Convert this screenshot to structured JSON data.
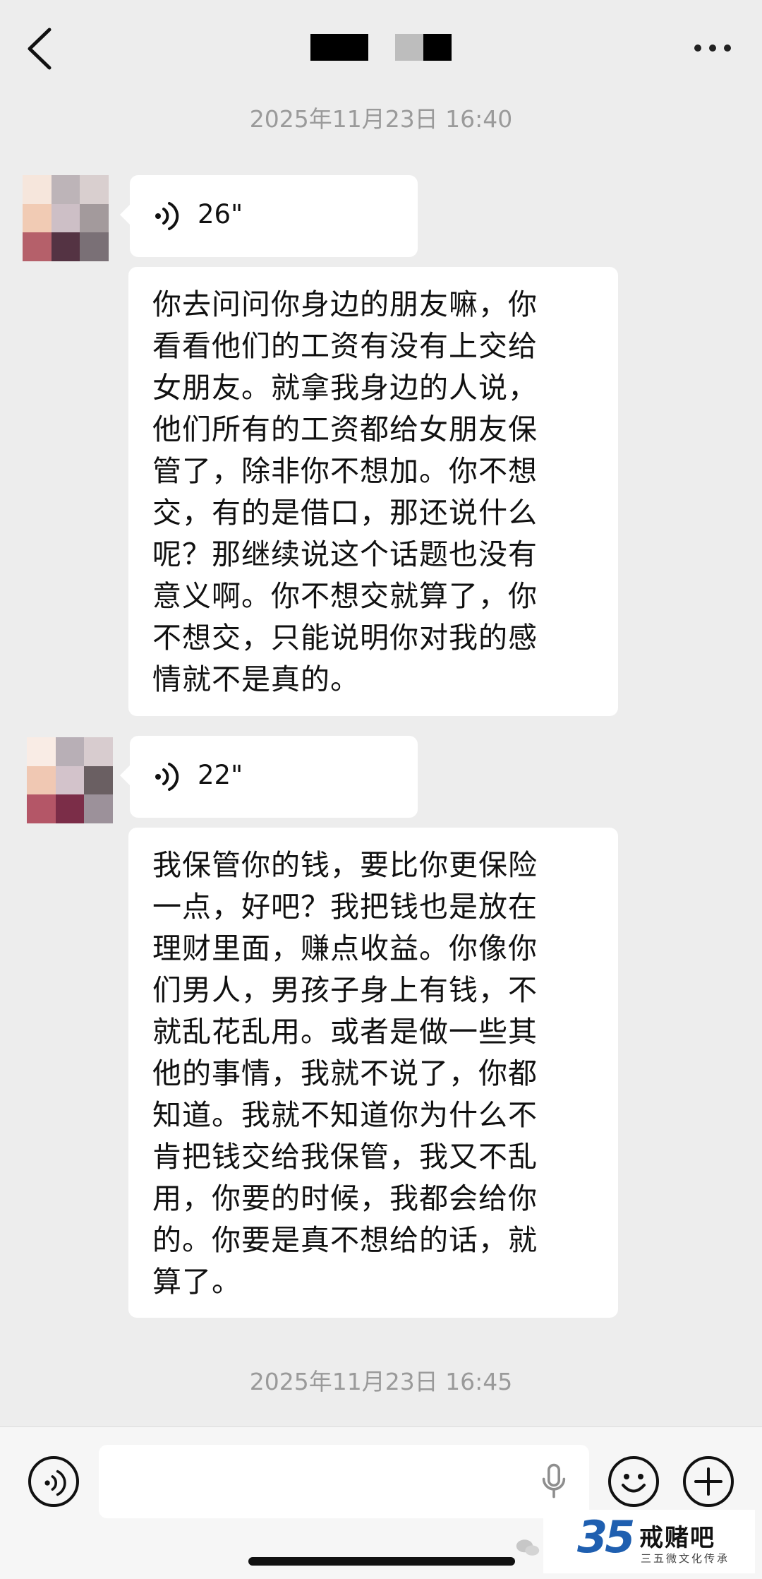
{
  "header": {
    "back_icon": "chevron-left-icon",
    "title_redacted": true,
    "more_icon": "more-dots-icon"
  },
  "messages": [
    {
      "type": "timestamp",
      "text": "2025年11月23日 16:40"
    },
    {
      "type": "voice",
      "duration": "26\""
    },
    {
      "type": "text",
      "lines": [
        "你去问问你身边的朋友嘛，你",
        "看看他们的工资有没有上交给",
        "女朋友。就拿我身边的人说，",
        "他们所有的工资都给女朋友保",
        "管了，除非你不想加。你不想",
        "交，有的是借口，那还说什么",
        "呢？那继续说这个话题也没有",
        "意义啊。你不想交就算了，你",
        "不想交，只能说明你对我的感",
        "情就不是真的。"
      ]
    },
    {
      "type": "voice",
      "duration": "22\""
    },
    {
      "type": "text",
      "lines": [
        "我保管你的钱，要比你更保险",
        "一点，好吧？我把钱也是放在",
        "理财里面，赚点收益。你像你",
        "们男人，男孩子身上有钱，不",
        "就乱花乱用。或者是做一些其",
        "他的事情，我就不说了，你都",
        "知道。我就不知道你为什么不",
        "肯把钱交给我保管，我又不乱",
        "用，你要的时候，我都会给你",
        "的。你要是真不想给的话，就",
        "算了。"
      ]
    },
    {
      "type": "timestamp",
      "text": "2025年11月23日 16:45"
    }
  ],
  "input_bar": {
    "voice_toggle_icon": "voice-wave-icon",
    "mic_icon": "microphone-icon",
    "emoji_icon": "smiley-icon",
    "add_icon": "plus-icon"
  },
  "watermark": {
    "logo_number": "35",
    "name": "戒赌吧",
    "tagline": "三五微文化传承"
  },
  "colors": {
    "background": "#ededed",
    "bubble": "#ffffff",
    "timestamp": "#9a9a9a",
    "logo_blue": "#1f5fb0",
    "logo_orange": "#f08a1c"
  }
}
